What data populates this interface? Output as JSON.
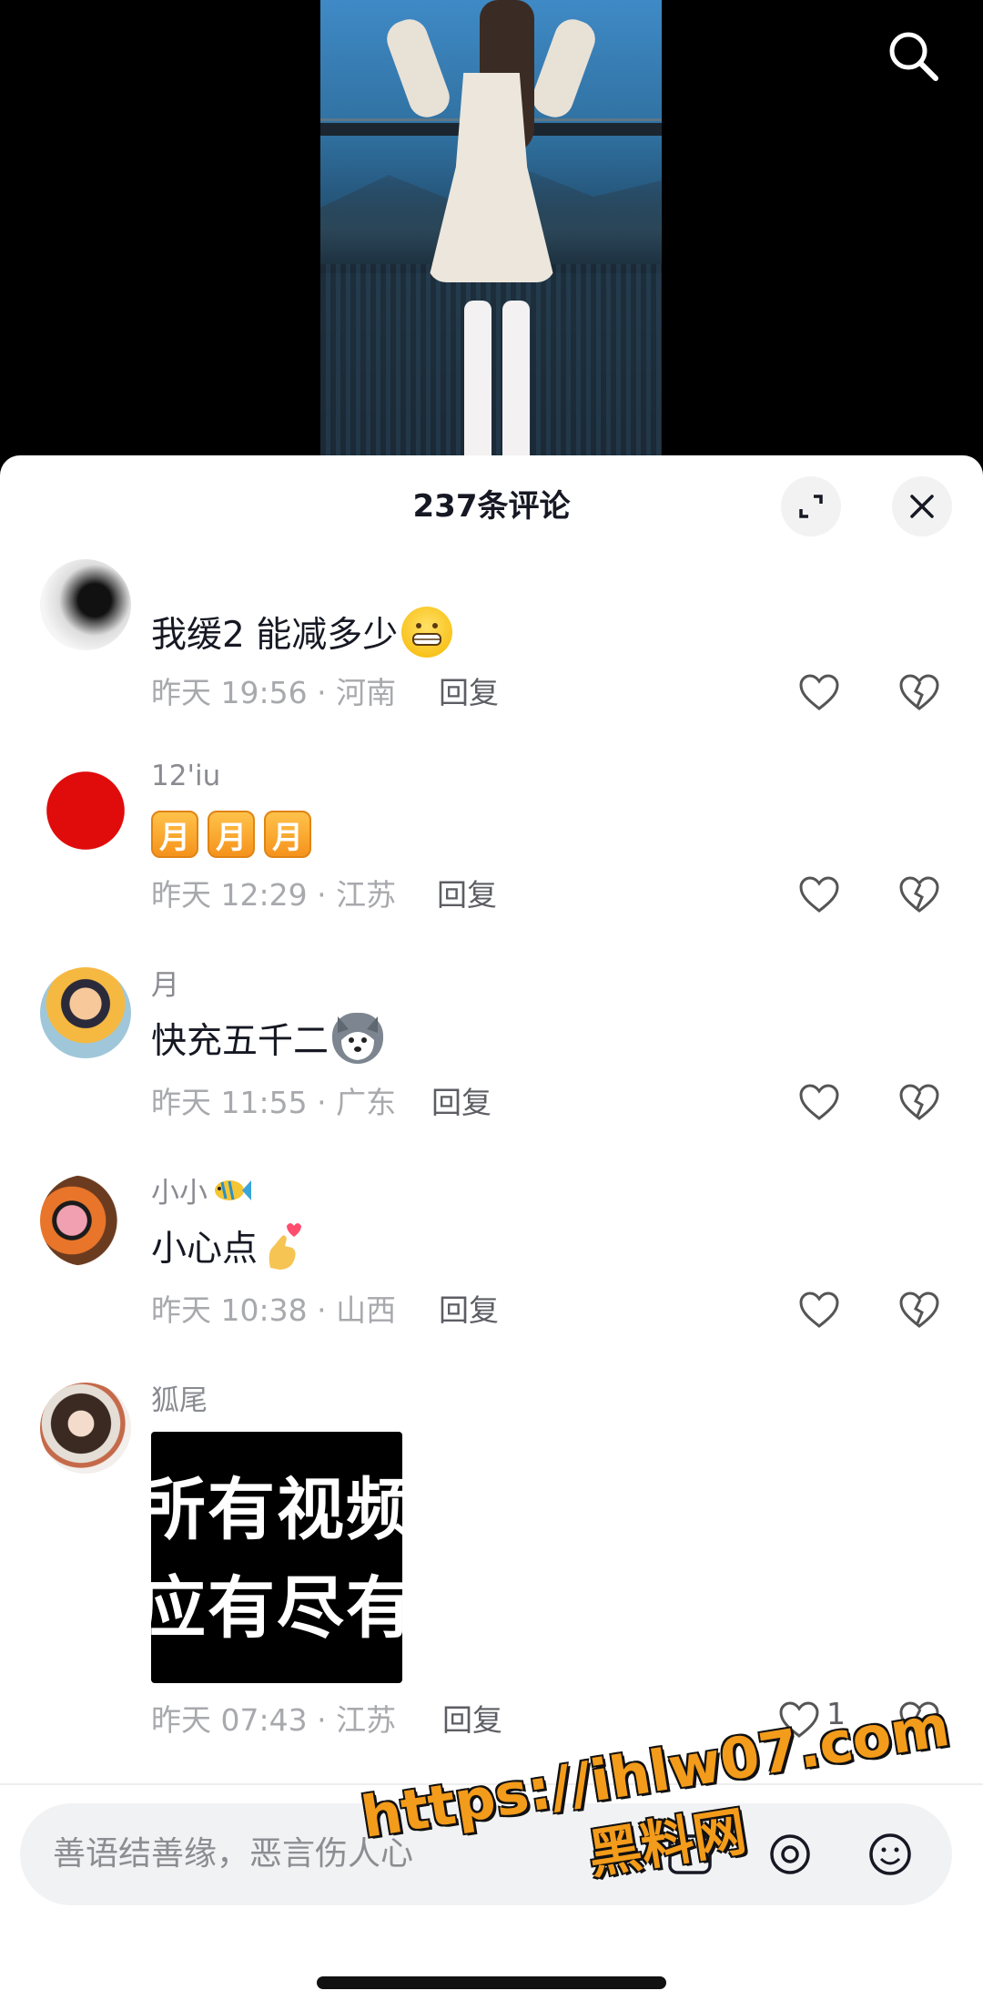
{
  "header": {
    "title": "237条评论"
  },
  "comments": [
    {
      "username": "",
      "text": "我缓2 能减多少",
      "emoji": "grinning-face",
      "time": "昨天 19:56",
      "location": "· 河南",
      "reply_label": "回复",
      "likes": ""
    },
    {
      "username": "12'iu",
      "text": "",
      "badges": [
        "月",
        "月",
        "月"
      ],
      "time": "昨天 12:29",
      "location": "· 江苏",
      "reply_label": "回复",
      "likes": ""
    },
    {
      "username": "月",
      "text": "快充五千二",
      "emoji": "husky-dog",
      "time": "昨天 11:55",
      "location": "· 广东",
      "reply_label": "回复",
      "likes": ""
    },
    {
      "username": "小小",
      "username_emoji": "fish",
      "text": "小心点",
      "emoji": "finger-heart",
      "time": "昨天 10:38",
      "location": "· 山西",
      "reply_label": "回复",
      "likes": ""
    },
    {
      "username": "狐尾",
      "text": "",
      "image_text": [
        "所有视频",
        "应有尽有"
      ],
      "time": "昨天 07:43",
      "location": "· 江苏",
      "reply_label": "回复",
      "likes": "1"
    }
  ],
  "input": {
    "placeholder": "善语结善缘，恶言伤人心"
  },
  "watermark": {
    "line1": "https://ihlw07.com",
    "line2": "黑料网"
  },
  "colors": {
    "accent_orange": "#f39b1a",
    "text_primary": "#161823",
    "text_secondary": "#a8a9ad"
  }
}
